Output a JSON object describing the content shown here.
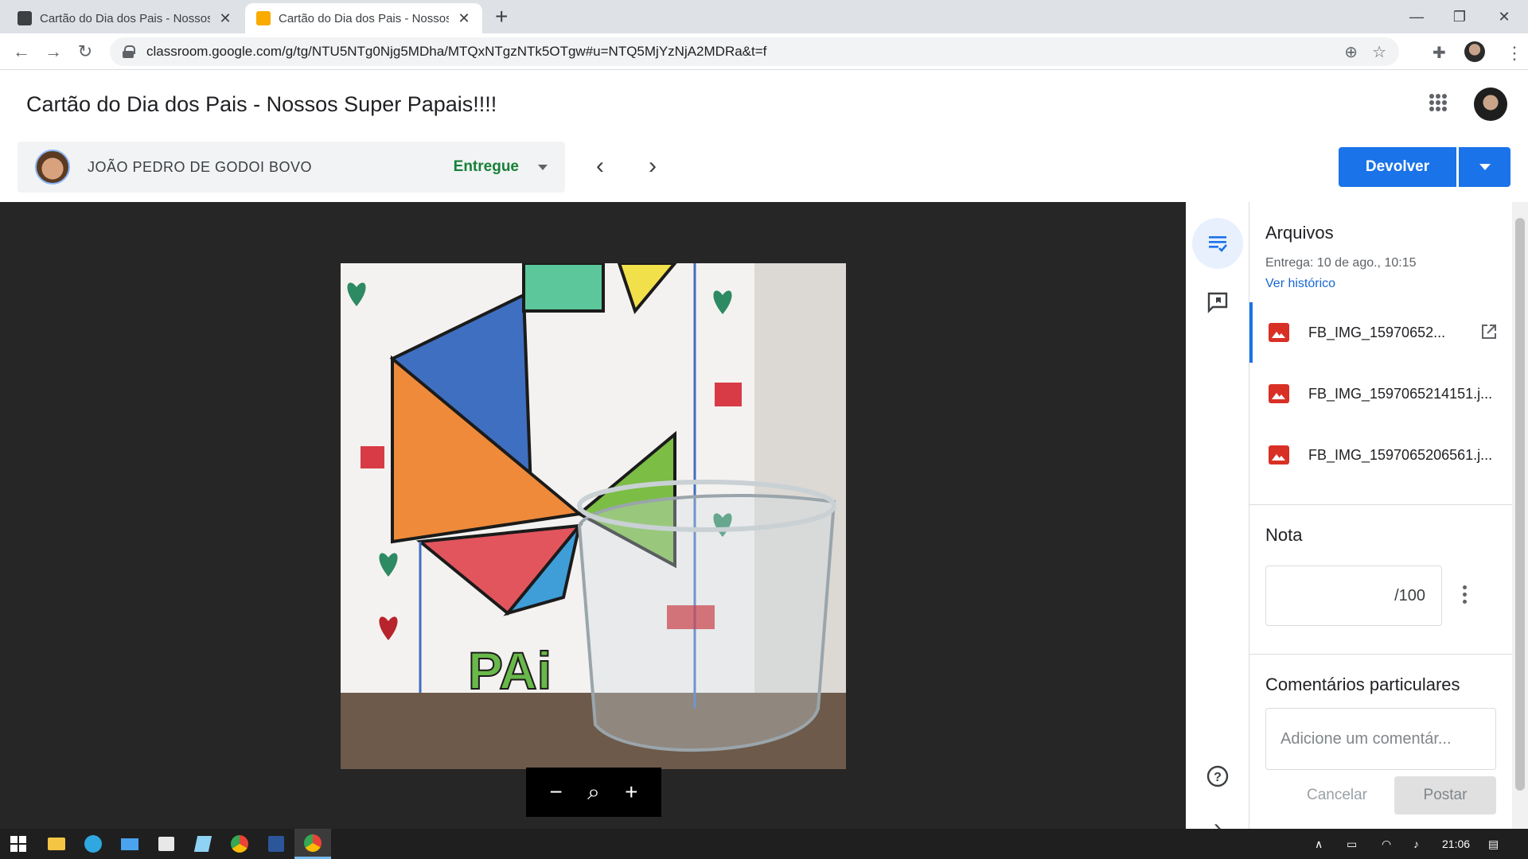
{
  "browser": {
    "tabs": [
      {
        "title": "Cartão do Dia dos Pais - Nossos Super Papais!!!!",
        "active": false
      },
      {
        "title": "Cartão do Dia dos Pais - Nossos Super Papais!!!!",
        "active": true
      }
    ],
    "url": "classroom.google.com/g/tg/NTU5NTg0Njg5MDha/MTQxNTgzNTk5OTgw#u=NTQ5MjYzNjA2MDRa&t=f"
  },
  "header": {
    "assignment_title": "Cartão do Dia dos Pais - Nossos Super Papais!!!!",
    "student_name": "JOÃO PEDRO DE GODOI BOVO",
    "status": "Entregue",
    "return_label": "Devolver"
  },
  "files_panel": {
    "title": "Arquivos",
    "submitted": "Entrega: 10 de ago., 10:15",
    "history_link": "Ver histórico",
    "files": [
      {
        "name": "FB_IMG_15970652...",
        "selected": true
      },
      {
        "name": "FB_IMG_1597065214151.j..."
      },
      {
        "name": "FB_IMG_1597065206561.j..."
      }
    ]
  },
  "grade": {
    "title": "Nota",
    "suffix": "/100"
  },
  "comments": {
    "title": "Comentários particulares",
    "placeholder": "Adicione um comentár...",
    "cancel": "Cancelar",
    "post": "Postar"
  },
  "photo": {
    "caption_text": "PAi"
  },
  "taskbar": {
    "time": "21:06"
  },
  "colors": {
    "primary": "#1a73e8",
    "status_green": "#188038",
    "file_icon_red": "#d93025"
  }
}
